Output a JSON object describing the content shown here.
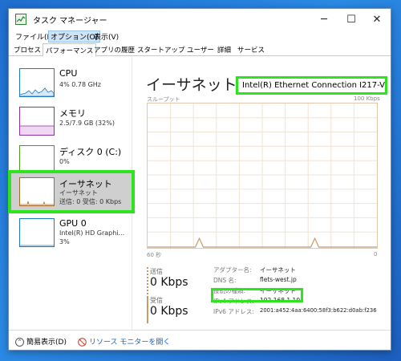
{
  "window": {
    "title": "タスク マネージャー",
    "controls": {
      "minimize": "─",
      "maximize": "☐",
      "close": "✕"
    }
  },
  "menu": [
    {
      "label": "ファイル(F)"
    },
    {
      "label": "オプション(O)"
    },
    {
      "label": "表示(V)"
    }
  ],
  "tabs": [
    {
      "label": "プロセス"
    },
    {
      "label": "パフォーマンス"
    },
    {
      "label": "アプリの履歴"
    },
    {
      "label": "スタートアップ"
    },
    {
      "label": "ユーザー"
    },
    {
      "label": "詳細"
    },
    {
      "label": "サービス"
    }
  ],
  "sidebar": {
    "items": [
      {
        "name": "CPU",
        "sub1": "4% 0.78 GHz",
        "sub2": "",
        "color": "#1d7ac6"
      },
      {
        "name": "メモリ",
        "sub1": "2.5/7.9 GB (32%)",
        "sub2": "",
        "color": "#8f2ea3"
      },
      {
        "name": "ディスク 0 (C:)",
        "sub1": "0%",
        "sub2": "",
        "color": "#4a9a1f"
      },
      {
        "name": "イーサネット",
        "sub1": "イーサネット",
        "sub2": "送信: 0 受信: 0 Kbps",
        "color": "#a36a2b"
      },
      {
        "name": "GPU 0",
        "sub1": "Intel(R) HD Graphi...",
        "sub2": "3%",
        "color": "#1d7ac6"
      }
    ]
  },
  "main": {
    "title": "イーサネット",
    "adapter": "Intel(R) Ethernet Connection I217-V",
    "graph": {
      "label_left": "スループット",
      "label_right": "100 Kbps",
      "time_left": "60 秒",
      "time_right": "0",
      "line_color": "#c89a6a"
    },
    "send": {
      "label": "送信",
      "value": "0 Kbps"
    },
    "receive": {
      "label": "受信",
      "value": "0 Kbps"
    },
    "details": [
      {
        "key": "アダプター名:",
        "value": "イーサネット"
      },
      {
        "key": "DNS 名:",
        "value": "flets-west.jp"
      },
      {
        "key": "接続の種類:",
        "value": "イーサネット"
      },
      {
        "key": "IPv4 アドレス:",
        "value": "192.168.1.10"
      },
      {
        "key": "IPv6 アドレス:",
        "value": "2001:a452:4aa:6400:58f3:b622:d0ab:f236"
      }
    ]
  },
  "footer": {
    "brief": "簡易表示(D)",
    "resource_monitor": "リソース モニターを開く"
  },
  "accent": {
    "highlight": "#2ee41e",
    "link": "#1a5fb4"
  }
}
